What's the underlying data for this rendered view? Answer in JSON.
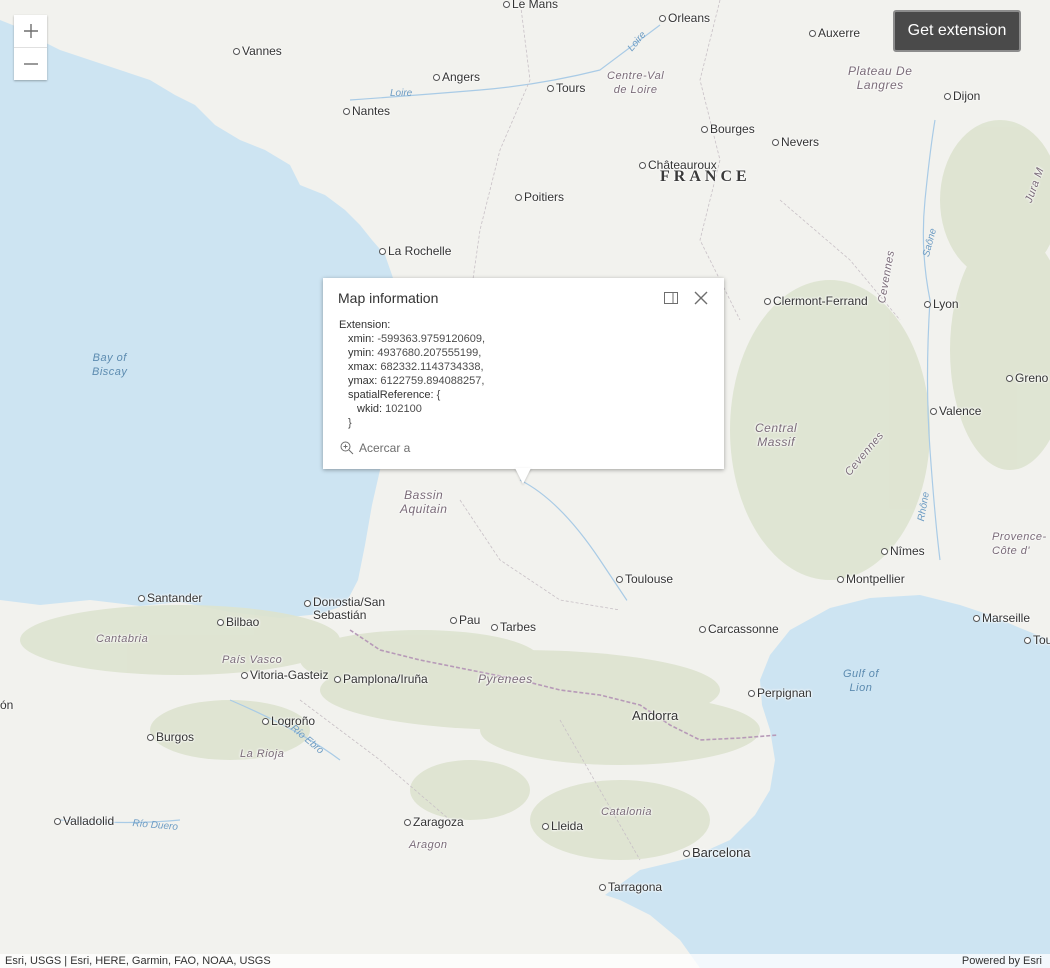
{
  "map": {
    "colors": {
      "sea": "#cde4f2",
      "land": "#f2f2ee",
      "mountain": "#d9dfc9",
      "border": "#b79ab8"
    },
    "labels": {
      "le_mans": "Le Mans",
      "orleans": "Orleans",
      "auxerre": "Auxerre",
      "vannes": "Vannes",
      "angers": "Angers",
      "tours": "Tours",
      "dijon": "Dijon",
      "nantes": "Nantes",
      "bourges": "Bourges",
      "nevers": "Nevers",
      "chateauroux": "Châteauroux",
      "poitiers": "Poitiers",
      "la_rochelle": "La Rochelle",
      "clermont": "Clermont-Ferrand",
      "lyon": "Lyon",
      "grenoble": "Greno",
      "valence": "Valence",
      "nimes": "Nîmes",
      "montpellier": "Montpellier",
      "marseille": "Marseille",
      "toulon": "Tou",
      "toulouse": "Toulouse",
      "carcassonne": "Carcassonne",
      "perpignan": "Perpignan",
      "andorra": "Andorra",
      "santander": "Santander",
      "bilbao": "Bilbao",
      "donostia": "Donostia/San\nSebastián",
      "pau": "Pau",
      "tarbes": "Tarbes",
      "vitoria": "Vitoria-Gasteiz",
      "pamplona": "Pamplona/Iruña",
      "leon": "ón",
      "logrono": "Logroño",
      "burgos": "Burgos",
      "valladolid": "Valladolid",
      "zaragoza": "Zaragoza",
      "lleida": "Lleida",
      "barcelona": "Barcelona",
      "tarragona": "Tarragona"
    },
    "regions": {
      "france": "FRANCE",
      "centre": "Centre-Val\nde Loire",
      "plateau": "Plateau De\nLangres",
      "massif": "Central\nMassif",
      "cevennes1": "Cevennes",
      "cevennes2": "Cevennes",
      "bassin": "Bassin\nAquitain",
      "provence": "Provence-\nCôte d'",
      "jura": "Jura M",
      "cantabria": "Cantabria",
      "pais_vasco": "País Vasco",
      "pyrenees": "Pyrenees",
      "la_rioja": "La Rioja",
      "aragon": "Aragon",
      "catalonia": "Catalonia"
    },
    "water": {
      "biscay": "Bay of\nBiscay",
      "gulf_lion": "Gulf of\nLion",
      "loire1": "Loire",
      "loire2": "Loire",
      "saone": "Saône",
      "rhone": "Rhône",
      "ebro": "Río Ebro",
      "duero": "Río Duero"
    }
  },
  "controls": {
    "zoom_in": "+",
    "zoom_out": "—",
    "get_extension": "Get extension"
  },
  "popup": {
    "title": "Map information",
    "body": {
      "heading": "Extension:",
      "xmin_key": "xmin:",
      "xmin_val": "-599363.9759120609,",
      "ymin_key": "ymin:",
      "ymin_val": "4937680.207555199,",
      "xmax_key": "xmax:",
      "xmax_val": "682332.1143734338,",
      "ymax_key": "ymax:",
      "ymax_val": "6122759.894088257,",
      "sr_key": "spatialReference:",
      "sr_open": "{",
      "wkid_key": "wkid:",
      "wkid_val": "102100",
      "sr_close": "}"
    },
    "zoom_to": "Acercar a"
  },
  "attribution": {
    "sources": "Esri, USGS | Esri, HERE, Garmin, FAO, NOAA, USGS",
    "powered": "Powered by Esri"
  }
}
